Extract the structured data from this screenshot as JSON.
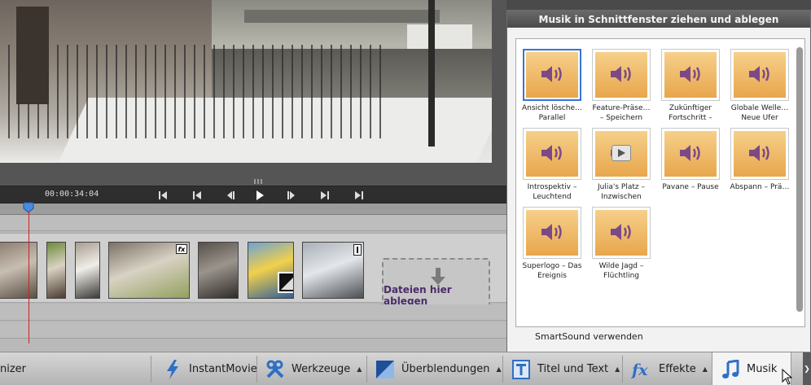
{
  "preview": {
    "timecode": "00:00:34:04",
    "transport_icons": [
      "go-to-start-icon",
      "previous-edit-icon",
      "step-back-icon",
      "play-icon",
      "step-forward-icon",
      "next-edit-icon",
      "go-to-end-icon"
    ]
  },
  "timeline": {
    "clips": [
      {
        "badge": "none",
        "palette": [
          "#8d7f70",
          "#c7beb2",
          "#5b4f44"
        ]
      },
      {
        "badge": "none",
        "palette": [
          "#6e8a3a",
          "#d9d2c2",
          "#4b3b32"
        ]
      },
      {
        "badge": "none",
        "palette": [
          "#a79c90",
          "#f0eee8",
          "#3c3a38"
        ]
      },
      {
        "badge": "fx",
        "palette": [
          "#7a7266",
          "#d8d2c4",
          "#93a05e"
        ]
      },
      {
        "badge": "none",
        "palette": [
          "#56504a",
          "#9a948c",
          "#2f2b28"
        ]
      },
      {
        "badge": "transition",
        "palette": [
          "#6fa2d2",
          "#f2d04a",
          "#2f5f9a"
        ]
      },
      {
        "badge": "marker",
        "palette": [
          "#a9b0b6",
          "#e3e6ea",
          "#4c4f53"
        ]
      }
    ],
    "fx_label": "fx",
    "drop_target_label": "Dateien hier ablegen"
  },
  "music_panel": {
    "title": "Musik in Schnittfenster ziehen und ablegen",
    "tiles": [
      {
        "label": "Ansicht lösche…\nParallel",
        "selected": true,
        "icon": "speaker-icon"
      },
      {
        "label": "Feature-Präse…\n– Speichern",
        "selected": false,
        "icon": "speaker-icon"
      },
      {
        "label": "Zukünftiger\nFortschritt –",
        "selected": false,
        "icon": "speaker-icon"
      },
      {
        "label": "Globale Welle…\nNeue Ufer",
        "selected": false,
        "icon": "speaker-icon"
      },
      {
        "label": "Introspektiv –\nLeuchtend",
        "selected": false,
        "icon": "speaker-icon"
      },
      {
        "label": "Julia's Platz –\nInzwischen",
        "selected": false,
        "icon": "play-preview-icon"
      },
      {
        "label": "Pavane – Pause",
        "selected": false,
        "icon": "speaker-icon"
      },
      {
        "label": "Abspann – Prä…",
        "selected": false,
        "icon": "speaker-icon"
      },
      {
        "label": "Superlogo – Das\nEreignis",
        "selected": false,
        "icon": "speaker-icon"
      },
      {
        "label": "Wilde Jagd –\nFlüchtling",
        "selected": false,
        "icon": "speaker-icon"
      }
    ],
    "smartsound_label": "SmartSound verwenden"
  },
  "toolbar": {
    "organizer_partial": "nizer",
    "items": [
      {
        "label": "InstantMovie",
        "icon": "lightning-icon",
        "has_caret": false
      },
      {
        "label": "Werkzeuge",
        "icon": "tools-icon",
        "has_caret": true
      },
      {
        "label": "Überblendungen",
        "icon": "transition-icon",
        "has_caret": true
      },
      {
        "label": "Titel und Text",
        "icon": "title-icon",
        "has_caret": true
      },
      {
        "label": "Effekte",
        "icon": "fx-icon",
        "has_caret": true
      },
      {
        "label": "Musik",
        "icon": "music-note-icon",
        "has_caret": false
      }
    ],
    "caret_char": "▲",
    "more_char": "❯",
    "active_item": "Musik"
  },
  "colors": {
    "accent_selection": "#3873d9",
    "audio_tile": "#e8a64c",
    "speaker_purple": "#7b4a86",
    "playhead": "#d02020",
    "drop_label": "#4b2c6b"
  }
}
